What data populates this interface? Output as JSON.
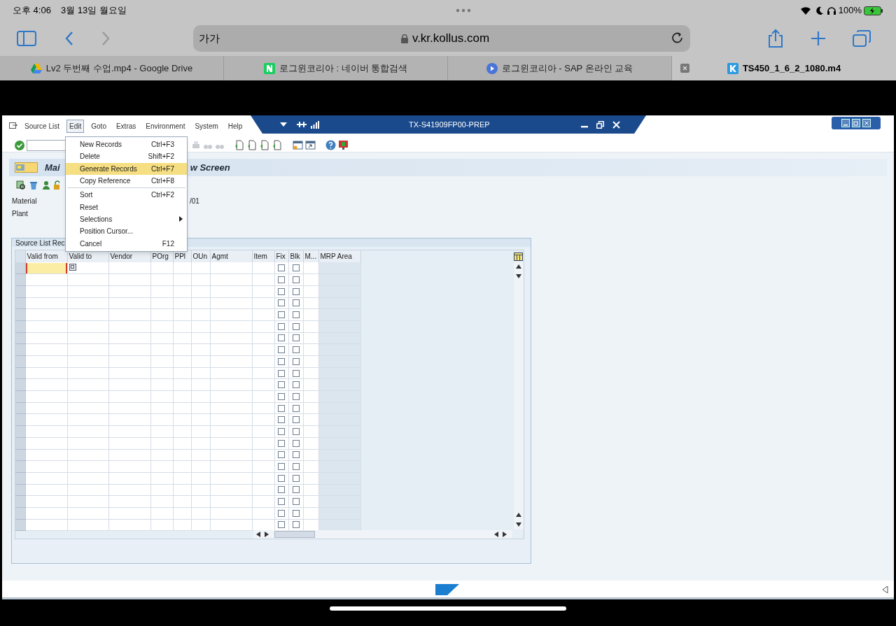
{
  "status_bar": {
    "time": "오후 4:06",
    "date": "3월 13일 월요일",
    "battery": "100%"
  },
  "browser": {
    "text_size_button": "가가",
    "url": "v.kr.kollus.com"
  },
  "tabs": [
    {
      "label": "Lv2 두번째 수업.mp4 - Google Drive",
      "kind": "drive",
      "selected": false
    },
    {
      "label": "로그윈코리아 : 네이버 통합검색",
      "kind": "naver",
      "selected": false
    },
    {
      "label": "로그윈코리아 - SAP 온라인 교육",
      "kind": "play",
      "selected": false
    },
    {
      "label": "TS450_1_6_2_1080.m4",
      "kind": "kollus",
      "selected": true
    }
  ],
  "sap": {
    "menu": [
      {
        "label": "Source List",
        "selected": false
      },
      {
        "label": "Edit",
        "selected": true
      },
      {
        "label": "Goto",
        "selected": false
      },
      {
        "label": "Extras",
        "selected": false
      },
      {
        "label": "Environment",
        "selected": false
      },
      {
        "label": "System",
        "selected": false
      },
      {
        "label": "Help",
        "selected": false
      }
    ],
    "system_title": "TX-S41909FP00-PREP",
    "screen_title_start": "Mai",
    "screen_title_end": "w Screen",
    "fields": [
      {
        "label": "Material",
        "value_visible": "/01"
      },
      {
        "label": "Plant"
      }
    ],
    "group_title": "Source List Rec",
    "table": {
      "columns": [
        "Valid from",
        "Valid to",
        "Vendor",
        "POrg",
        "PPl",
        "OUn",
        "Agmt",
        "Item",
        "Fix",
        "Blk",
        "M...",
        "MRP Area"
      ],
      "rows": [
        {
          "fix": false,
          "blk": false
        },
        {
          "fix": false,
          "blk": false
        },
        {
          "fix": false,
          "blk": false
        },
        {
          "fix": false,
          "blk": false
        },
        {
          "fix": false,
          "blk": false
        },
        {
          "fix": false,
          "blk": false
        },
        {
          "fix": false,
          "blk": false
        },
        {
          "fix": false,
          "blk": false
        },
        {
          "fix": false,
          "blk": false
        },
        {
          "fix": false,
          "blk": false
        },
        {
          "fix": false,
          "blk": false
        },
        {
          "fix": false,
          "blk": false
        },
        {
          "fix": false,
          "blk": false
        },
        {
          "fix": false,
          "blk": false
        },
        {
          "fix": false,
          "blk": false
        },
        {
          "fix": false,
          "blk": false
        },
        {
          "fix": false,
          "blk": false
        },
        {
          "fix": false,
          "blk": false
        },
        {
          "fix": false,
          "blk": false
        },
        {
          "fix": false,
          "blk": false
        },
        {
          "fix": false,
          "blk": false
        },
        {
          "fix": false,
          "blk": false
        },
        {
          "fix": false,
          "blk": false
        }
      ]
    },
    "edit_menu": [
      {
        "label": "New Records",
        "shortcut": "Ctrl+F3",
        "selected": false
      },
      {
        "label": "Delete",
        "shortcut": "Shift+F2",
        "selected": false
      },
      {
        "label": "Generate Records",
        "shortcut": "Ctrl+F7",
        "selected": true
      },
      {
        "label": "Copy Reference",
        "shortcut": "Ctrl+F8",
        "selected": false
      },
      {
        "label": "Sort",
        "shortcut": "Ctrl+F2",
        "selected": false,
        "separator_before": true
      },
      {
        "label": "Reset",
        "selected": false
      },
      {
        "label": "Selections",
        "selected": false,
        "submenu": true
      },
      {
        "label": "Position Cursor...",
        "selected": false
      },
      {
        "label": "Cancel",
        "shortcut": "F12",
        "selected": false
      }
    ]
  }
}
